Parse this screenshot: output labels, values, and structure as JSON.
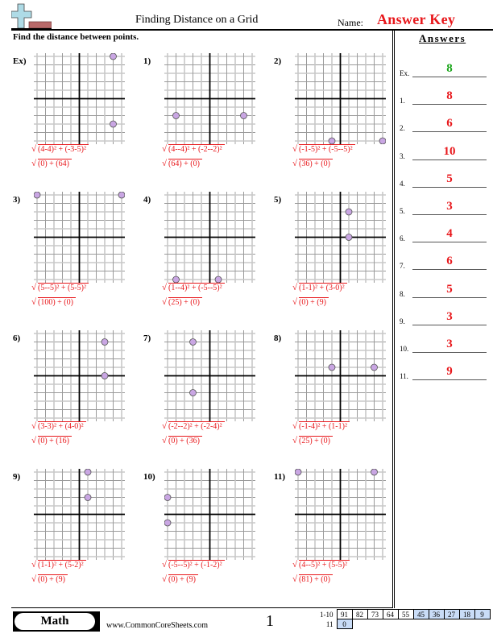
{
  "header": {
    "title": "Finding Distance on a Grid",
    "name_label": "Name:",
    "answer_key": "Answer Key",
    "instructions": "Find the distance between points."
  },
  "answers": {
    "title": "Answers",
    "items": [
      {
        "label": "Ex.",
        "value": "8"
      },
      {
        "label": "1.",
        "value": "8"
      },
      {
        "label": "2.",
        "value": "6"
      },
      {
        "label": "3.",
        "value": "10"
      },
      {
        "label": "4.",
        "value": "5"
      },
      {
        "label": "5.",
        "value": "3"
      },
      {
        "label": "6.",
        "value": "4"
      },
      {
        "label": "7.",
        "value": "6"
      },
      {
        "label": "8.",
        "value": "5"
      },
      {
        "label": "9.",
        "value": "3"
      },
      {
        "label": "10.",
        "value": "3"
      },
      {
        "label": "11.",
        "value": "9"
      }
    ]
  },
  "colors": {
    "answer_red": "#e8181c",
    "example_green": "#1aa51a",
    "point_fill": "#c9a6e3",
    "score_blue": "#c9dcf7"
  },
  "grid_range": [
    -5,
    5
  ],
  "problems": [
    {
      "label": "Ex)",
      "points": [
        [
          4,
          5
        ],
        [
          4,
          -3
        ]
      ],
      "formula1": "(4-4)² + (-3-5)²",
      "formula2": "(0) + (64)"
    },
    {
      "label": "1)",
      "points": [
        [
          -4,
          -2
        ],
        [
          4,
          -2
        ]
      ],
      "formula1": "(4--4)² + (-2--2)²",
      "formula2": "(64) + (0)"
    },
    {
      "label": "2)",
      "points": [
        [
          -1,
          -5
        ],
        [
          5,
          -5
        ]
      ],
      "formula1": "(-1-5)² + (-5--5)²",
      "formula2": "(36) + (0)"
    },
    {
      "label": "3)",
      "points": [
        [
          -5,
          5
        ],
        [
          5,
          5
        ]
      ],
      "formula1": "(5--5)² + (5-5)²",
      "formula2": "(100) + (0)"
    },
    {
      "label": "4)",
      "points": [
        [
          -4,
          -5
        ],
        [
          1,
          -5
        ]
      ],
      "formula1": "(1--4)² + (-5--5)²",
      "formula2": "(25) + (0)"
    },
    {
      "label": "5)",
      "points": [
        [
          1,
          3
        ],
        [
          1,
          0
        ]
      ],
      "formula1": "(1-1)² + (3-0)²",
      "formula2": "(0) + (9)"
    },
    {
      "label": "6)",
      "points": [
        [
          3,
          4
        ],
        [
          3,
          0
        ]
      ],
      "formula1": "(3-3)² + (4-0)²",
      "formula2": "(0) + (16)"
    },
    {
      "label": "7)",
      "points": [
        [
          -2,
          4
        ],
        [
          -2,
          -2
        ]
      ],
      "formula1": "(-2--2)² + (-2-4)²",
      "formula2": "(0) + (36)"
    },
    {
      "label": "8)",
      "points": [
        [
          -1,
          1
        ],
        [
          4,
          1
        ]
      ],
      "formula1": "(-1-4)² + (1-1)²",
      "formula2": "(25) + (0)"
    },
    {
      "label": "9)",
      "points": [
        [
          1,
          5
        ],
        [
          1,
          2
        ]
      ],
      "formula1": "(1-1)² + (5-2)²",
      "formula2": "(0) + (9)"
    },
    {
      "label": "10)",
      "points": [
        [
          -5,
          2
        ],
        [
          -5,
          -1
        ]
      ],
      "formula1": "(-5--5)² + (-1-2)²",
      "formula2": "(0) + (9)"
    },
    {
      "label": "11)",
      "points": [
        [
          -5,
          5
        ],
        [
          4,
          5
        ]
      ],
      "formula1": "(4--5)² + (5-5)²",
      "formula2": "(81) + (0)"
    }
  ],
  "footer": {
    "subject": "Math",
    "website": "www.CommonCoreSheets.com",
    "page": "1",
    "score_rows": [
      {
        "label": "1-10",
        "scores": [
          "91",
          "82",
          "73",
          "64",
          "55",
          "45",
          "36",
          "27",
          "18",
          "9"
        ],
        "highlight_from": 5
      },
      {
        "label": "11",
        "scores": [
          "0"
        ],
        "highlight_from": 0
      }
    ]
  }
}
